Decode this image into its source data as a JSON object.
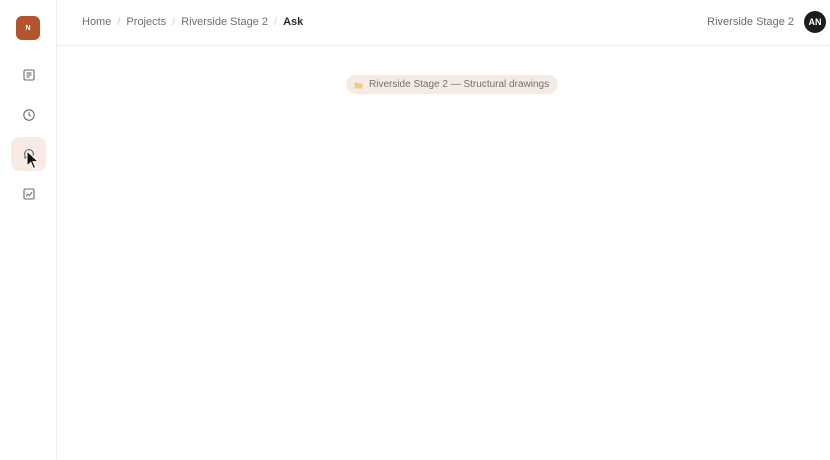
{
  "sidebar": {
    "logo_text": "N",
    "items": [
      {
        "name": "documents",
        "icon": "document-icon"
      },
      {
        "name": "history",
        "icon": "clock-icon"
      },
      {
        "name": "ask",
        "icon": "ask-icon",
        "active": true
      },
      {
        "name": "analytics",
        "icon": "chart-icon"
      }
    ]
  },
  "header": {
    "breadcrumb": [
      "Home",
      "Projects",
      "Riverside Stage 2",
      "Ask"
    ],
    "project_name": "Riverside Stage 2",
    "avatar_initials": "AN"
  },
  "context": {
    "chip_label": "Riverside Stage 2 — Structural drawings",
    "chip_icon": "folder-icon"
  },
  "colors": {
    "brand": "#b5552e",
    "active_bg": "#f7ebe3",
    "chip_bg": "#f4ebe5",
    "avatar_bg": "#1c1c1c"
  }
}
